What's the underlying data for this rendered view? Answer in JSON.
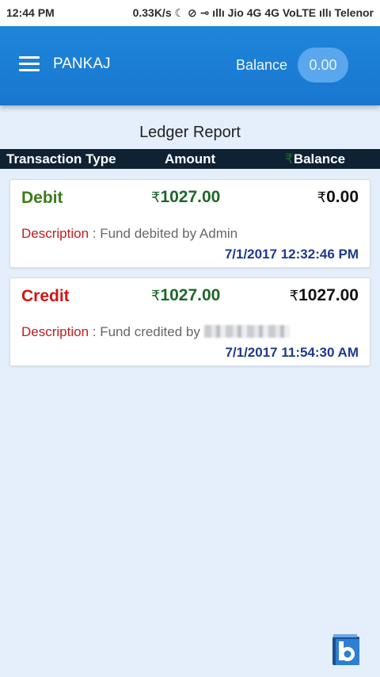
{
  "status_bar": {
    "time": "12:44 PM",
    "info": "0.33K/s ☾ ⊘ ⊸ ıllı Jio 4G 4G VoLTE ıllı Telenor"
  },
  "app_bar": {
    "user_name": "PANKAJ",
    "balance_label": "Balance",
    "balance_value": "0.00"
  },
  "report": {
    "title": "Ledger Report",
    "columns": {
      "type": "Transaction Type",
      "amount": "Amount",
      "balance": "Balance",
      "balance_symbol": "₹"
    }
  },
  "transactions": [
    {
      "type": "Debit",
      "currency": "₹",
      "amount": "1027.00",
      "balance": "0.00",
      "description_label": "Description",
      "description": " : Fund debited by Admin",
      "date": "7/1/2017 12:32:46 PM"
    },
    {
      "type": "Credit",
      "currency": "₹",
      "amount": "1027.00",
      "balance": "1027.00",
      "description_label": "Description",
      "description": " : Fund credited by ",
      "date": "7/1/2017 11:54:30 AM"
    }
  ],
  "icons": {
    "menu": "hamburger-menu-icon",
    "logo": "app-logo-icon"
  }
}
